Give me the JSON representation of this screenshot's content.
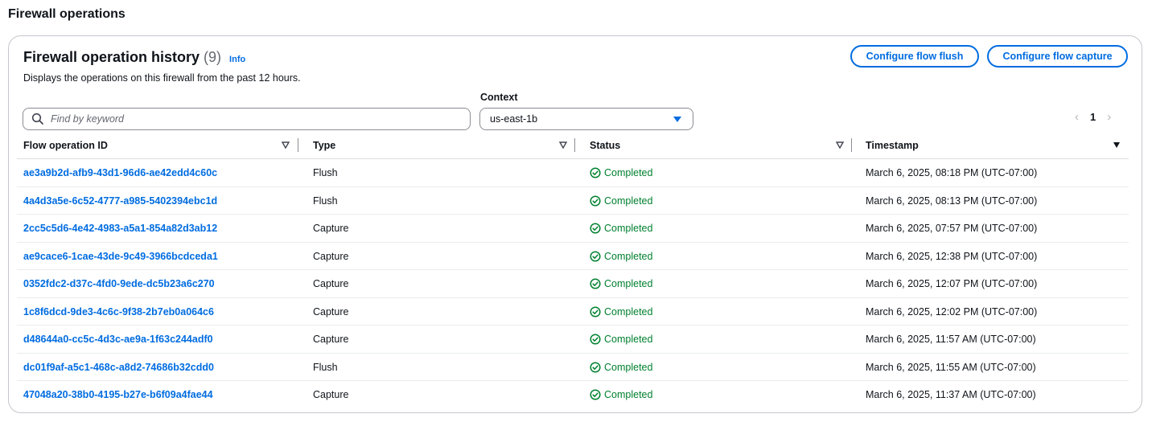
{
  "page": {
    "title": "Firewall operations"
  },
  "panel": {
    "title": "Firewall operation history",
    "count": "(9)",
    "info_label": "Info",
    "description": "Displays the operations on this firewall from the past 12 hours.",
    "buttons": {
      "flush": "Configure flow flush",
      "capture": "Configure flow capture"
    }
  },
  "search": {
    "placeholder": "Find by keyword",
    "value": ""
  },
  "context": {
    "label": "Context",
    "value": "us-east-1b"
  },
  "pagination": {
    "current": "1",
    "prev_icon": "chevron-left-icon",
    "next_icon": "chevron-right-icon"
  },
  "table": {
    "headers": {
      "id": "Flow operation ID",
      "type": "Type",
      "status": "Status",
      "timestamp": "Timestamp"
    },
    "rows": [
      {
        "id": "ae3a9b2d-afb9-43d1-96d6-ae42edd4c60c",
        "type": "Flush",
        "status": "Completed",
        "timestamp": "March 6, 2025, 08:18 PM (UTC-07:00)"
      },
      {
        "id": "4a4d3a5e-6c52-4777-a985-5402394ebc1d",
        "type": "Flush",
        "status": "Completed",
        "timestamp": "March 6, 2025, 08:13 PM (UTC-07:00)"
      },
      {
        "id": "2cc5c5d6-4e42-4983-a5a1-854a82d3ab12",
        "type": "Capture",
        "status": "Completed",
        "timestamp": "March 6, 2025, 07:57 PM (UTC-07:00)"
      },
      {
        "id": "ae9cace6-1cae-43de-9c49-3966bcdceda1",
        "type": "Capture",
        "status": "Completed",
        "timestamp": "March 6, 2025, 12:38 PM (UTC-07:00)"
      },
      {
        "id": "0352fdc2-d37c-4fd0-9ede-dc5b23a6c270",
        "type": "Capture",
        "status": "Completed",
        "timestamp": "March 6, 2025, 12:07 PM (UTC-07:00)"
      },
      {
        "id": "1c8f6dcd-9de3-4c6c-9f38-2b7eb0a064c6",
        "type": "Capture",
        "status": "Completed",
        "timestamp": "March 6, 2025, 12:02 PM (UTC-07:00)"
      },
      {
        "id": "d48644a0-cc5c-4d3c-ae9a-1f63c244adf0",
        "type": "Capture",
        "status": "Completed",
        "timestamp": "March 6, 2025, 11:57 AM (UTC-07:00)"
      },
      {
        "id": "dc01f9af-a5c1-468c-a8d2-74686b32cdd0",
        "type": "Flush",
        "status": "Completed",
        "timestamp": "March 6, 2025, 11:55 AM (UTC-07:00)"
      },
      {
        "id": "47048a20-38b0-4195-b27e-b6f09a4fae44",
        "type": "Capture",
        "status": "Completed",
        "timestamp": "March 6, 2025, 11:37 AM (UTC-07:00)"
      }
    ]
  },
  "colors": {
    "link": "#006ce0",
    "success": "#00802f",
    "border": "#c6c6cd",
    "text": "#0f141a"
  }
}
